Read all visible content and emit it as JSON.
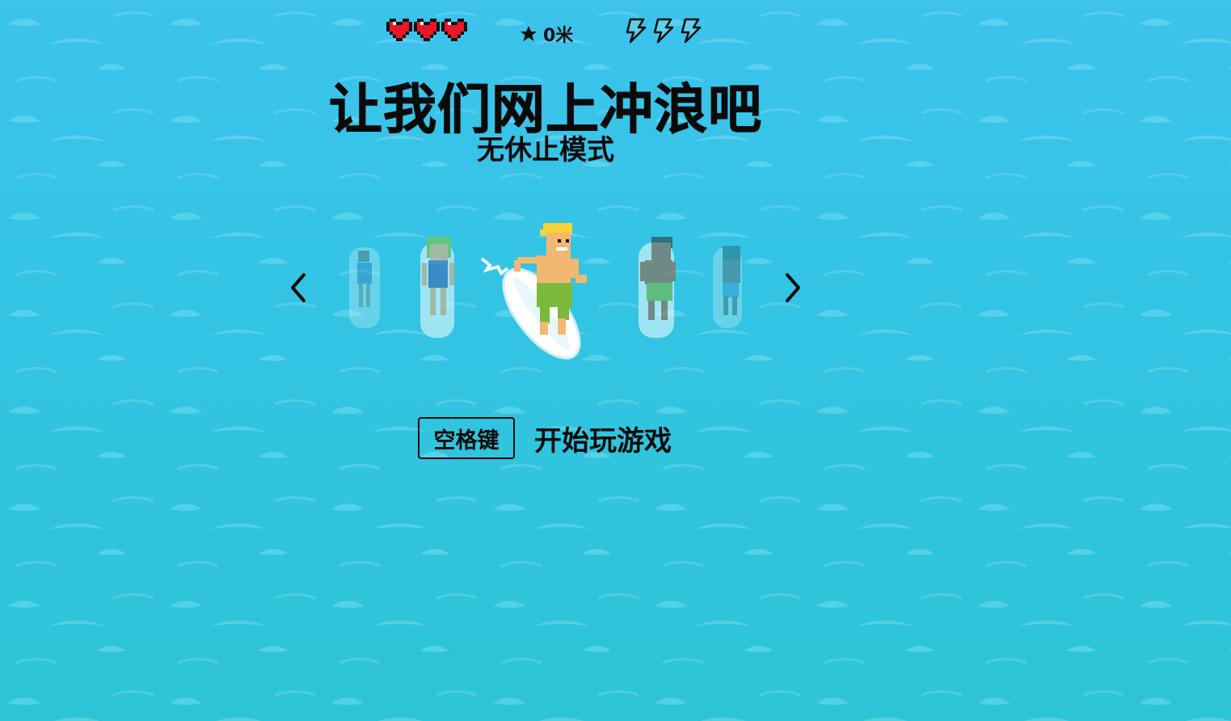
{
  "hud": {
    "lives": 3,
    "distance_value": "0米",
    "boosts": 3,
    "icons": {
      "life": "heart-icon",
      "distance": "star-icon",
      "boost": "lightning-icon"
    }
  },
  "title": "让我们网上冲浪吧",
  "mode": "无休止模式",
  "carousel": {
    "prev_icon": "chevron-left-icon",
    "next_icon": "chevron-right-icon",
    "selected": "surfer-blonde"
  },
  "start": {
    "key_label": "空格键",
    "action_label": "开始玩游戏"
  },
  "colors": {
    "water_top": "#3dc3ec",
    "water_bottom": "#2dc4d6",
    "heart": "#e8172a",
    "text": "#0b0b0b"
  }
}
